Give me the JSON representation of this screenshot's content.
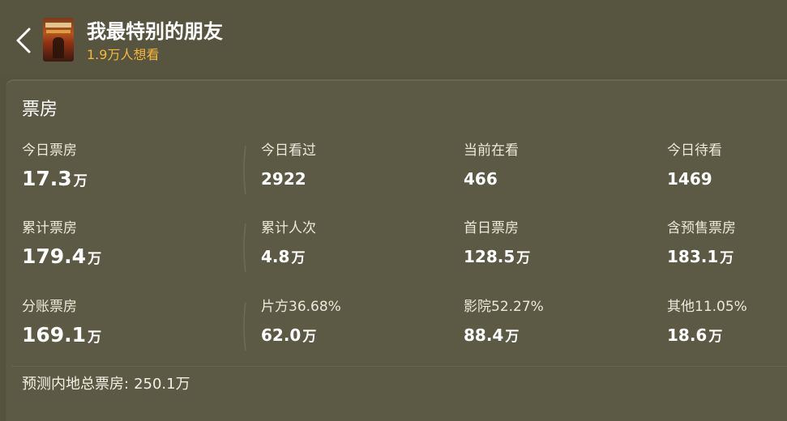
{
  "header": {
    "title": "我最特别的朋友",
    "want_count": "1.9万人想看"
  },
  "section": {
    "title": "票房"
  },
  "rows": [
    {
      "primary": {
        "label": "今日票房",
        "num": "17.3",
        "unit": "万"
      },
      "cells": [
        {
          "label": "今日看过",
          "num": "2922",
          "unit": ""
        },
        {
          "label": "当前在看",
          "num": "466",
          "unit": ""
        },
        {
          "label": "今日待看",
          "num": "1469",
          "unit": ""
        }
      ]
    },
    {
      "primary": {
        "label": "累计票房",
        "num": "179.4",
        "unit": "万"
      },
      "cells": [
        {
          "label": "累计人次",
          "num": "4.8",
          "unit": "万"
        },
        {
          "label": "首日票房",
          "num": "128.5",
          "unit": "万"
        },
        {
          "label": "含预售票房",
          "num": "183.1",
          "unit": "万"
        }
      ]
    },
    {
      "primary": {
        "label": "分账票房",
        "num": "169.1",
        "unit": "万"
      },
      "cells": [
        {
          "label": "片方36.68%",
          "num": "62.0",
          "unit": "万"
        },
        {
          "label": "影院52.27%",
          "num": "88.4",
          "unit": "万"
        },
        {
          "label": "其他11.05%",
          "num": "18.6",
          "unit": "万"
        }
      ]
    }
  ],
  "forecast": {
    "label": "预测内地总票房:",
    "value": "250.1万"
  },
  "colors": {
    "background": "#55533e",
    "want_accent": "#f5b73c"
  }
}
